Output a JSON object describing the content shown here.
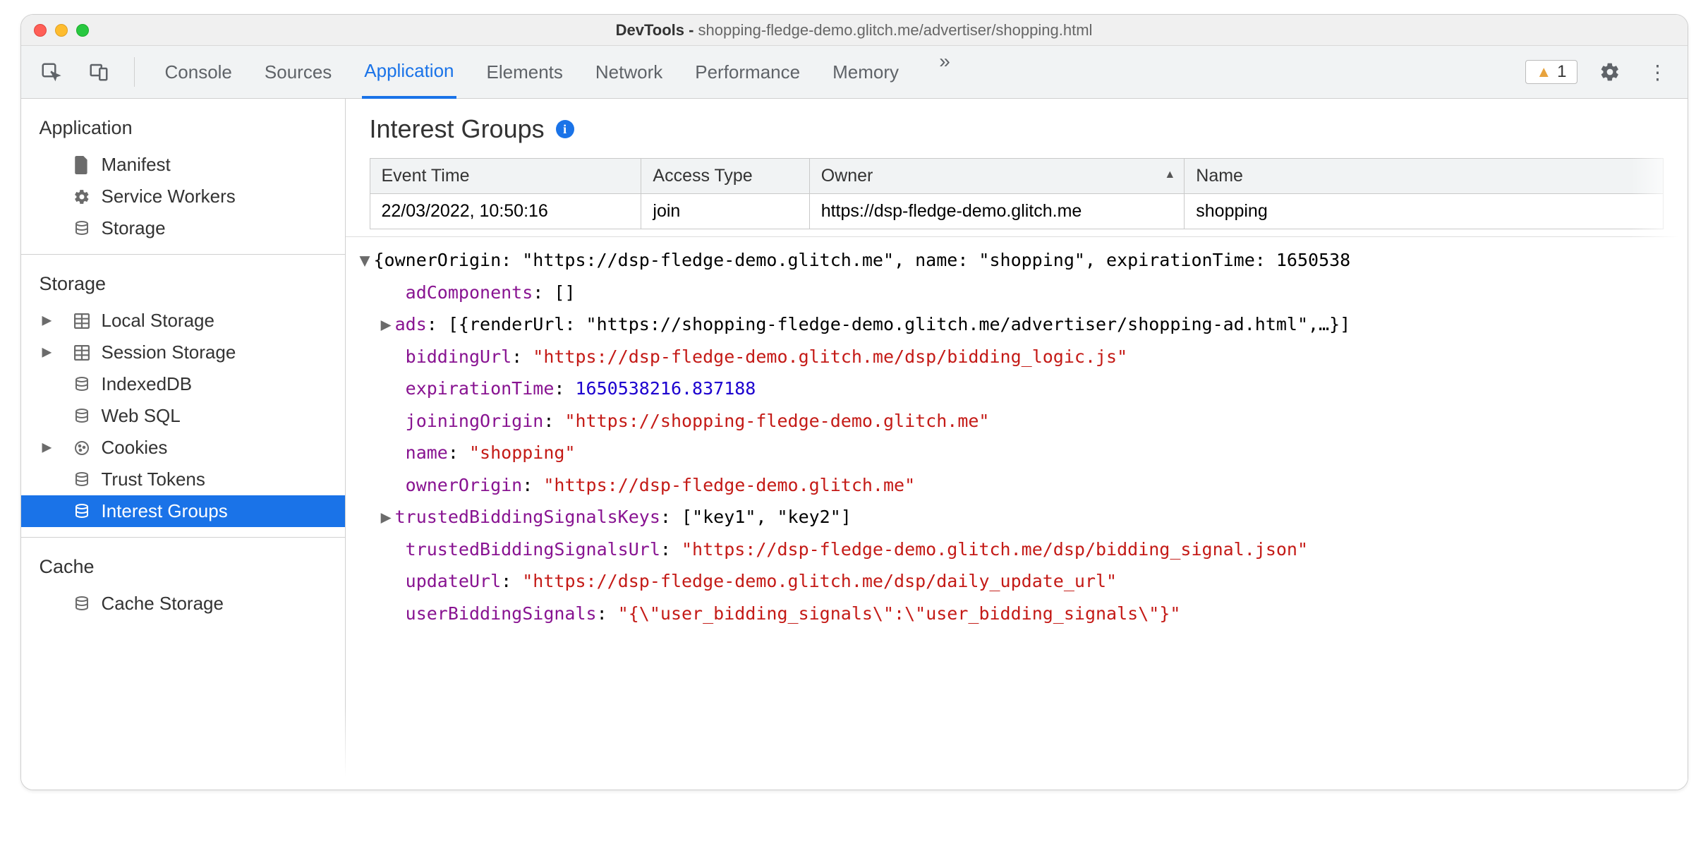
{
  "window": {
    "title_prefix": "DevTools - ",
    "title_url": "shopping-fledge-demo.glitch.me/advertiser/shopping.html"
  },
  "toolbar": {
    "tabs": [
      "Console",
      "Sources",
      "Application",
      "Elements",
      "Network",
      "Performance",
      "Memory"
    ],
    "active_tab": "Application",
    "warnings": "1"
  },
  "sidebar": {
    "sections": [
      {
        "title": "Application",
        "items": [
          {
            "label": "Manifest",
            "icon": "file"
          },
          {
            "label": "Service Workers",
            "icon": "gear"
          },
          {
            "label": "Storage",
            "icon": "db"
          }
        ]
      },
      {
        "title": "Storage",
        "items": [
          {
            "label": "Local Storage",
            "icon": "table",
            "expand": true
          },
          {
            "label": "Session Storage",
            "icon": "table",
            "expand": true
          },
          {
            "label": "IndexedDB",
            "icon": "db"
          },
          {
            "label": "Web SQL",
            "icon": "db"
          },
          {
            "label": "Cookies",
            "icon": "cookie",
            "expand": true
          },
          {
            "label": "Trust Tokens",
            "icon": "db"
          },
          {
            "label": "Interest Groups",
            "icon": "db",
            "selected": true
          }
        ]
      },
      {
        "title": "Cache",
        "items": [
          {
            "label": "Cache Storage",
            "icon": "db"
          }
        ]
      }
    ]
  },
  "panel": {
    "heading": "Interest Groups",
    "table": {
      "columns": [
        "Event Time",
        "Access Type",
        "Owner",
        "Name"
      ],
      "sort_column_index": 2,
      "rows": [
        {
          "time": "22/03/2022, 10:50:16",
          "type": "join",
          "owner": "https://dsp-fledge-demo.glitch.me",
          "name": "shopping"
        }
      ]
    },
    "details": {
      "summary": "{ownerOrigin: \"https://dsp-fledge-demo.glitch.me\", name: \"shopping\", expirationTime: 1650538",
      "adComponents": "[]",
      "ads_summary": "[{renderUrl: \"https://shopping-fledge-demo.glitch.me/advertiser/shopping-ad.html\",…}]",
      "biddingUrl": "\"https://dsp-fledge-demo.glitch.me/dsp/bidding_logic.js\"",
      "expirationTime": "1650538216.837188",
      "joiningOrigin": "\"https://shopping-fledge-demo.glitch.me\"",
      "name": "\"shopping\"",
      "ownerOrigin": "\"https://dsp-fledge-demo.glitch.me\"",
      "trustedBiddingSignalsKeys": "[\"key1\", \"key2\"]",
      "trustedBiddingSignalsUrl": "\"https://dsp-fledge-demo.glitch.me/dsp/bidding_signal.json\"",
      "updateUrl": "\"https://dsp-fledge-demo.glitch.me/dsp/daily_update_url\"",
      "userBiddingSignals": "\"{\\\"user_bidding_signals\\\":\\\"user_bidding_signals\\\"}\""
    }
  }
}
